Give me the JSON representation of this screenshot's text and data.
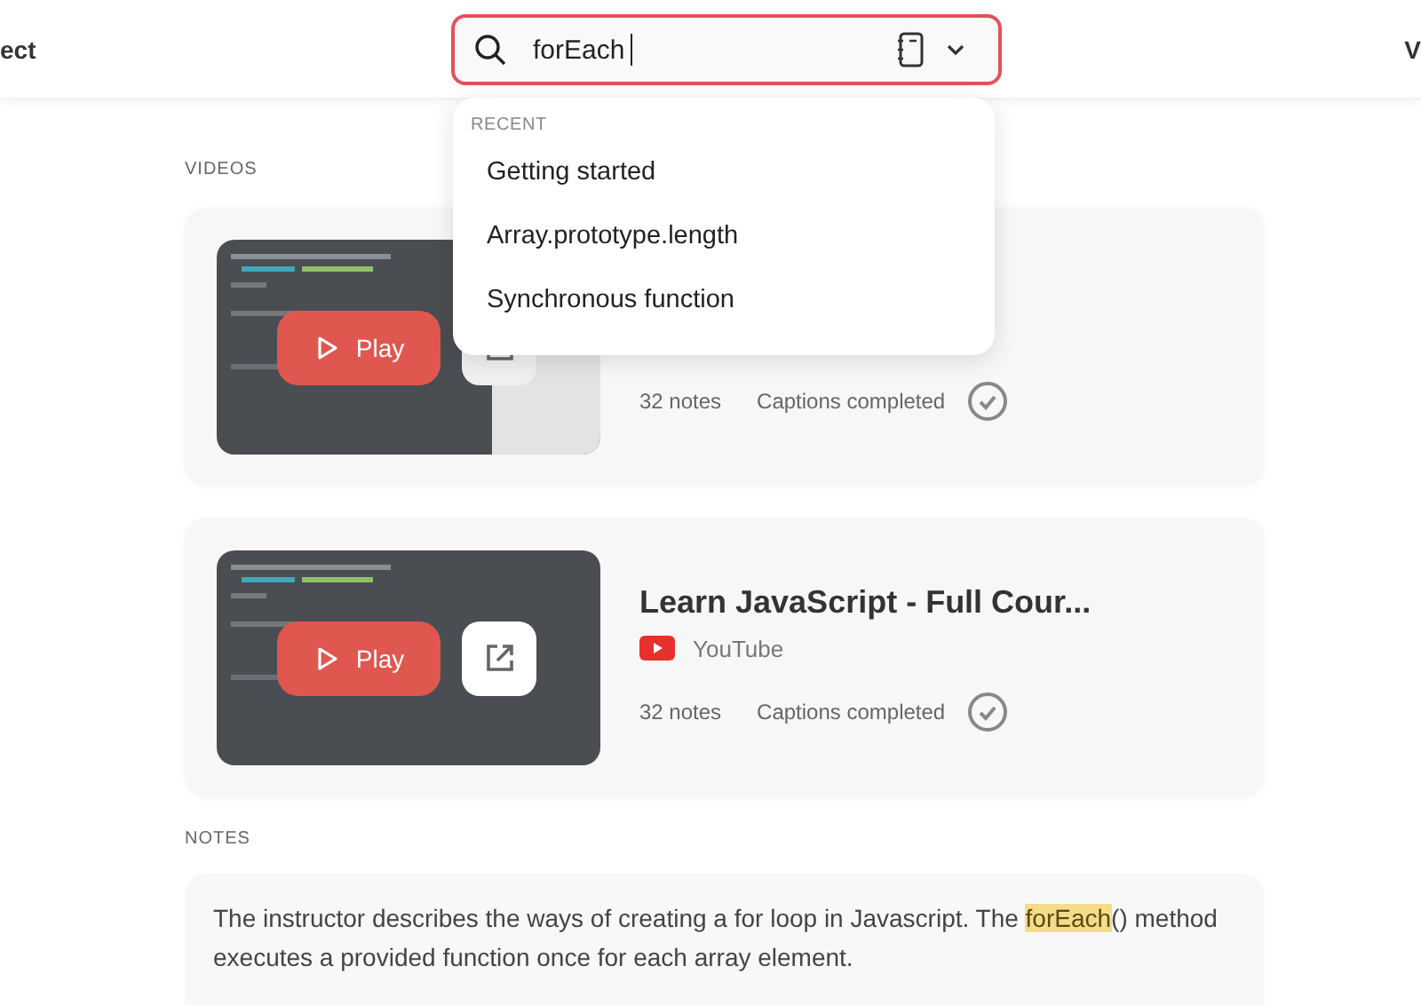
{
  "nav": {
    "left": "ect",
    "right": "V"
  },
  "search": {
    "value": "forEach"
  },
  "dropdown": {
    "heading": "RECENT",
    "items": [
      {
        "label": "Getting started"
      },
      {
        "label": "Array.prototype.length"
      },
      {
        "label": "Synchronous function"
      }
    ]
  },
  "videos": {
    "heading": "VIDEOS",
    "items": [
      {
        "play": "Play",
        "notes": "32 notes",
        "captions": "Captions completed",
        "captions_done": true,
        "share": false
      },
      {
        "title": "Learn JavaScript - Full Cour...",
        "source": "YouTube",
        "play": "Play",
        "notes": "32 notes",
        "captions": "Captions completed",
        "captions_done": true,
        "share": true
      }
    ]
  },
  "notes": {
    "heading": "NOTES",
    "items": [
      {
        "text": "The instructor describes the ways of creating a for loop in Javascript. The **forEach**() method executes a provided function once for each array element."
      }
    ]
  }
}
